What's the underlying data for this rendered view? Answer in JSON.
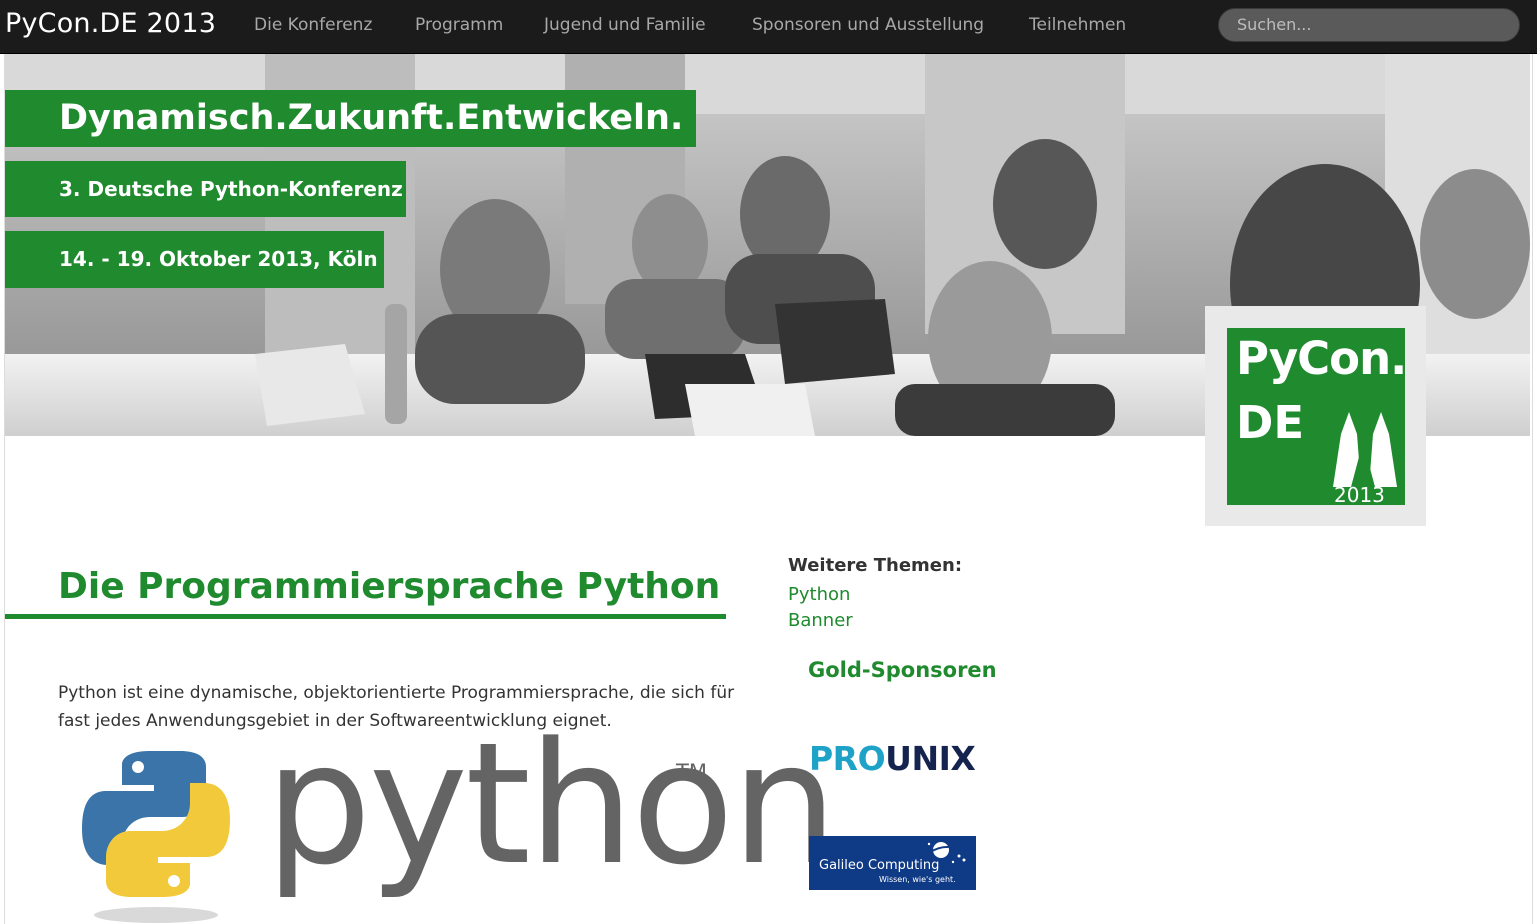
{
  "navbar": {
    "brand": "PyCon.DE 2013",
    "items": [
      "Die Konferenz",
      "Programm",
      "Jugend und Familie",
      "Sponsoren und Ausstellung",
      "Teilnehmen"
    ],
    "search_placeholder": "Suchen..."
  },
  "hero": {
    "tagline": "Dynamisch.Zukunft.Entwickeln.",
    "subtitle": "3. Deutsche Python-Konferenz",
    "date": "14. - 19. Oktober 2013, Köln"
  },
  "logo": {
    "line1": "PyCon.",
    "line2": "DE",
    "year": "2013"
  },
  "main": {
    "title": "Die Programmiersprache Python",
    "paragraph": "Python ist eine dynamische, objektorientierte Programmiersprache, die sich für fast jedes Anwendungsgebiet in der Softwareentwicklung eignet.",
    "python_logo_word": "python",
    "python_logo_tm": "TM"
  },
  "sidebar": {
    "heading": "Weitere Themen:",
    "links": [
      "Python",
      "Banner"
    ],
    "gold_heading": "Gold-Sponsoren",
    "sponsor1_part1": "PRO",
    "sponsor1_part2": "UNIX",
    "sponsor2_name": "Galileo Computing",
    "sponsor2_slogan": "Wissen, wie's geht."
  },
  "colors": {
    "accent_green": "#1f8a2e",
    "navbar_bg": "#1b1b1b",
    "prounix_cyan": "#1fa2c7",
    "prounix_navy": "#14244f",
    "galileo_blue": "#0f3a86"
  }
}
